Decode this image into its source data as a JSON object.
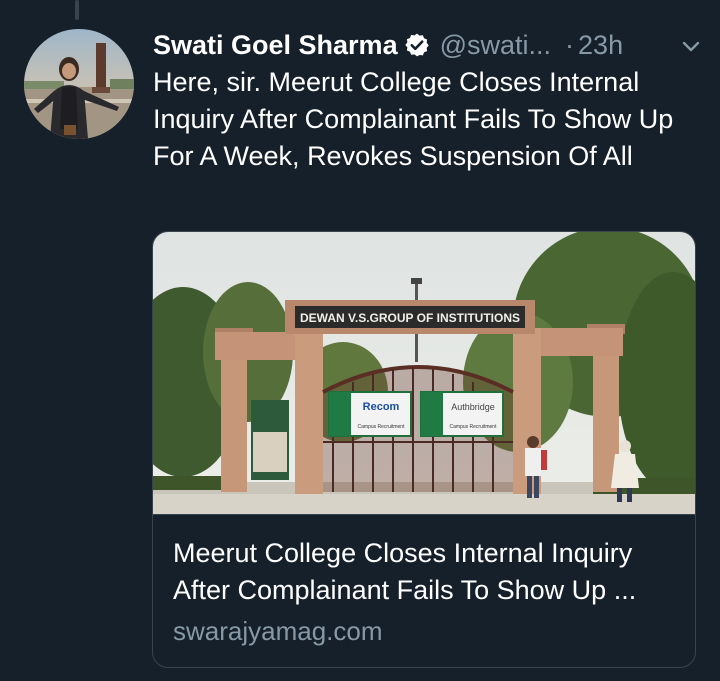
{
  "tweet": {
    "author_name": "Swati Goel Sharma",
    "handle": "@swati...",
    "separator": "·",
    "time": "23h",
    "text": "Here, sir. Meerut College Closes Internal Inquiry After Complainant Fails To Show Up For A Week, Revokes Suspension Of All",
    "icons": {
      "verified": "verified-badge-icon",
      "menu": "chevron-down-icon"
    },
    "colors": {
      "background": "#15202b",
      "secondary_text": "#8899a6",
      "border": "#38444d"
    }
  },
  "card": {
    "title": "Meerut College Closes Internal Inquiry After Complainant Fails To Show Up ...",
    "domain": "swarajyamag.com",
    "image": {
      "gate_sign": "DEWAN V.S.GROUP OF INSTITUTIONS",
      "banner_left": "Recom",
      "banner_right": "Authbridge",
      "banner_caption": "Campus Recruitment"
    }
  }
}
